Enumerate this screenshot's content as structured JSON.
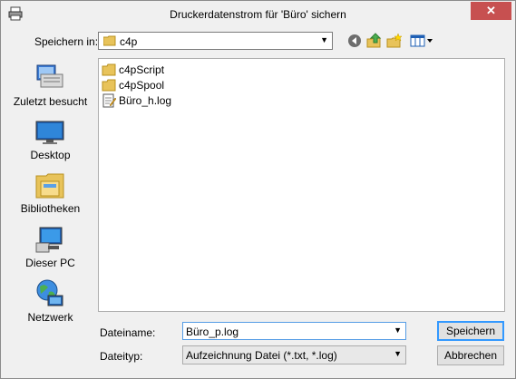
{
  "window": {
    "title": "Druckerdatenstrom für 'Büro' sichern",
    "close_glyph": "✕"
  },
  "location": {
    "label": "Speichern in:",
    "value": "c4p",
    "arrow": "▼"
  },
  "toolbar": [
    "back-icon",
    "up-folder-icon",
    "new-folder-icon",
    "view-menu-icon"
  ],
  "sidebar": {
    "items": [
      {
        "label": "Zuletzt besucht",
        "icon": "recent-places-icon"
      },
      {
        "label": "Desktop",
        "icon": "desktop-icon"
      },
      {
        "label": "Bibliotheken",
        "icon": "libraries-icon"
      },
      {
        "label": "Dieser PC",
        "icon": "this-pc-icon"
      },
      {
        "label": "Netzwerk",
        "icon": "network-icon"
      }
    ]
  },
  "files": [
    {
      "name": "c4pScript",
      "icon": "folder-icon"
    },
    {
      "name": "c4pSpool",
      "icon": "folder-icon"
    },
    {
      "name": "Büro_h.log",
      "icon": "log-file-icon"
    }
  ],
  "form": {
    "filename_label": "Dateiname:",
    "filename_value": "Büro_p.log",
    "filetype_label": "Dateityp:",
    "filetype_value": "Aufzeichnung Datei (*.txt, *.log)",
    "arrow": "▼"
  },
  "buttons": {
    "save": "Speichern",
    "cancel": "Abbrechen"
  },
  "colors": {
    "close_button": "#c75050",
    "focus_border": "#569de5",
    "window_bg": "#f0f0f0"
  }
}
